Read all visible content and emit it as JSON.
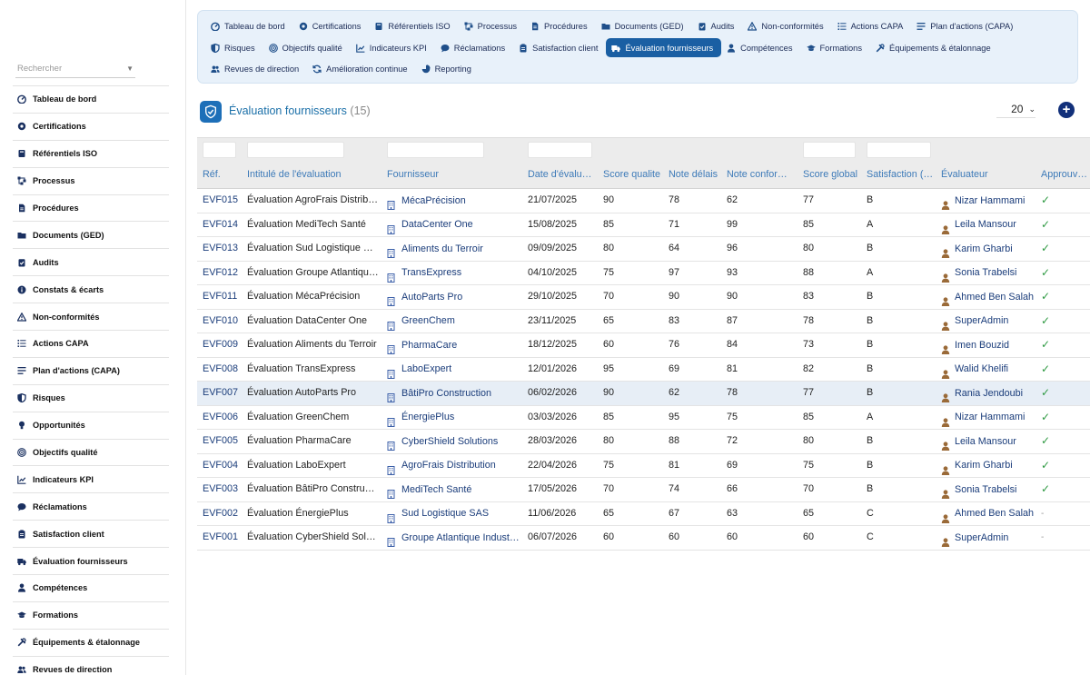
{
  "sidebar": {
    "search_placeholder": "Rechercher",
    "items": [
      {
        "label": "Tableau de bord",
        "icon": "dashboard-icon"
      },
      {
        "label": "Certifications",
        "icon": "certificate-icon"
      },
      {
        "label": "Référentiels ISO",
        "icon": "book-icon"
      },
      {
        "label": "Processus",
        "icon": "sitemap-icon"
      },
      {
        "label": "Procédures",
        "icon": "file-icon"
      },
      {
        "label": "Documents (GED)",
        "icon": "folder-icon"
      },
      {
        "label": "Audits",
        "icon": "clipboard-check-icon"
      },
      {
        "label": "Constats & écarts",
        "icon": "info-circle-icon"
      },
      {
        "label": "Non-conformités",
        "icon": "warning-icon"
      },
      {
        "label": "Actions CAPA",
        "icon": "list-icon"
      },
      {
        "label": "Plan d'actions (CAPA)",
        "icon": "tasks-icon"
      },
      {
        "label": "Risques",
        "icon": "shield-icon"
      },
      {
        "label": "Opportunités",
        "icon": "lightbulb-icon"
      },
      {
        "label": "Objectifs qualité",
        "icon": "target-icon"
      },
      {
        "label": "Indicateurs KPI",
        "icon": "line-chart-icon"
      },
      {
        "label": "Réclamations",
        "icon": "comment-icon"
      },
      {
        "label": "Satisfaction client",
        "icon": "clipboard-icon"
      },
      {
        "label": "Évaluation fournisseurs",
        "icon": "truck-icon"
      },
      {
        "label": "Compétences",
        "icon": "user-tie-icon"
      },
      {
        "label": "Formations",
        "icon": "graduation-cap-icon"
      },
      {
        "label": "Équipements & étalonnage",
        "icon": "tools-icon"
      },
      {
        "label": "Revues de direction",
        "icon": "users-icon"
      }
    ]
  },
  "topnav": {
    "rows": [
      [
        {
          "label": "Tableau de bord",
          "icon": "dashboard-icon"
        },
        {
          "label": "Certifications",
          "icon": "certificate-icon"
        },
        {
          "label": "Référentiels ISO",
          "icon": "book-icon"
        },
        {
          "label": "Processus",
          "icon": "sitemap-icon"
        },
        {
          "label": "Procédures",
          "icon": "file-icon"
        },
        {
          "label": "Documents (GED)",
          "icon": "folder-icon"
        },
        {
          "label": "Audits",
          "icon": "clipboard-check-icon"
        },
        {
          "label": "Non-conformités",
          "icon": "warning-icon"
        },
        {
          "label": "Actions CAPA",
          "icon": "list-icon"
        },
        {
          "label": "Plan d'actions (CAPA)",
          "icon": "tasks-icon"
        }
      ],
      [
        {
          "label": "Risques",
          "icon": "shield-icon"
        },
        {
          "label": "Objectifs qualité",
          "icon": "target-icon"
        },
        {
          "label": "Indicateurs KPI",
          "icon": "line-chart-icon"
        },
        {
          "label": "Réclamations",
          "icon": "comment-icon"
        },
        {
          "label": "Satisfaction client",
          "icon": "clipboard-icon"
        },
        {
          "label": "Évaluation fournisseurs",
          "icon": "truck-icon",
          "active": true
        },
        {
          "label": "Compétences",
          "icon": "user-tie-icon"
        },
        {
          "label": "Formations",
          "icon": "graduation-cap-icon"
        },
        {
          "label": "Équipements & étalonnage",
          "icon": "tools-icon"
        }
      ],
      [
        {
          "label": "Revues de direction",
          "icon": "users-icon"
        },
        {
          "label": "Amélioration continue",
          "icon": "sync-icon"
        },
        {
          "label": "Reporting",
          "icon": "pie-chart-icon"
        }
      ]
    ]
  },
  "header": {
    "title": "Évaluation fournisseurs",
    "count": "(15)",
    "page_size": "20"
  },
  "colors": {
    "accent": "#1a5fa3",
    "link": "#1a3c7a",
    "header_text": "#3d7ab8",
    "approved": "#2f9a43",
    "add_button": "#12307a"
  },
  "table": {
    "columns": [
      "Réf.",
      "Intitulé de l'évaluation",
      "Fournisseur",
      "Date d'évalu…",
      "Score qualite",
      "Note délais",
      "Note confor…",
      "Score global",
      "Satisfaction (…",
      "Évaluateur",
      "Approuv…"
    ],
    "rows": [
      {
        "ref": "EVF015",
        "title": "Évaluation AgroFrais Distrib…",
        "supplier": "MécaPrécision",
        "date": "21/07/2025",
        "quality": "90",
        "delay": "78",
        "conformity": "62",
        "global": "77",
        "satisfaction": "B",
        "evaluator": "Nizar Hammami",
        "approved": true
      },
      {
        "ref": "EVF014",
        "title": "Évaluation MediTech Santé",
        "supplier": "DataCenter One",
        "date": "15/08/2025",
        "quality": "85",
        "delay": "71",
        "conformity": "99",
        "global": "85",
        "satisfaction": "A",
        "evaluator": "Leila Mansour",
        "approved": true
      },
      {
        "ref": "EVF013",
        "title": "Évaluation Sud Logistique S…",
        "supplier": "Aliments du Terroir",
        "date": "09/09/2025",
        "quality": "80",
        "delay": "64",
        "conformity": "96",
        "global": "80",
        "satisfaction": "B",
        "evaluator": "Karim Gharbi",
        "approved": true
      },
      {
        "ref": "EVF012",
        "title": "Évaluation Groupe Atlantiqu…",
        "supplier": "TransExpress",
        "date": "04/10/2025",
        "quality": "75",
        "delay": "97",
        "conformity": "93",
        "global": "88",
        "satisfaction": "A",
        "evaluator": "Sonia Trabelsi",
        "approved": true
      },
      {
        "ref": "EVF011",
        "title": "Évaluation MécaPrécision",
        "supplier": "AutoParts Pro",
        "date": "29/10/2025",
        "quality": "70",
        "delay": "90",
        "conformity": "90",
        "global": "83",
        "satisfaction": "B",
        "evaluator": "Ahmed Ben Salah",
        "approved": true
      },
      {
        "ref": "EVF010",
        "title": "Évaluation DataCenter One",
        "supplier": "GreenChem",
        "date": "23/11/2025",
        "quality": "65",
        "delay": "83",
        "conformity": "87",
        "global": "78",
        "satisfaction": "B",
        "evaluator": "SuperAdmin",
        "approved": true
      },
      {
        "ref": "EVF009",
        "title": "Évaluation Aliments du Terroir",
        "supplier": "PharmaCare",
        "date": "18/12/2025",
        "quality": "60",
        "delay": "76",
        "conformity": "84",
        "global": "73",
        "satisfaction": "B",
        "evaluator": "Imen Bouzid",
        "approved": true
      },
      {
        "ref": "EVF008",
        "title": "Évaluation TransExpress",
        "supplier": "LaboExpert",
        "date": "12/01/2026",
        "quality": "95",
        "delay": "69",
        "conformity": "81",
        "global": "82",
        "satisfaction": "B",
        "evaluator": "Walid Khelifi",
        "approved": true
      },
      {
        "ref": "EVF007",
        "title": "Évaluation AutoParts Pro",
        "supplier": "BâtiPro Construction",
        "date": "06/02/2026",
        "quality": "90",
        "delay": "62",
        "conformity": "78",
        "global": "77",
        "satisfaction": "B",
        "evaluator": "Rania Jendoubi",
        "approved": true,
        "highlight": true
      },
      {
        "ref": "EVF006",
        "title": "Évaluation GreenChem",
        "supplier": "ÉnergiePlus",
        "date": "03/03/2026",
        "quality": "85",
        "delay": "95",
        "conformity": "75",
        "global": "85",
        "satisfaction": "A",
        "evaluator": "Nizar Hammami",
        "approved": true
      },
      {
        "ref": "EVF005",
        "title": "Évaluation PharmaCare",
        "supplier": "CyberShield Solutions",
        "date": "28/03/2026",
        "quality": "80",
        "delay": "88",
        "conformity": "72",
        "global": "80",
        "satisfaction": "B",
        "evaluator": "Leila Mansour",
        "approved": true
      },
      {
        "ref": "EVF004",
        "title": "Évaluation LaboExpert",
        "supplier": "AgroFrais Distribution",
        "date": "22/04/2026",
        "quality": "75",
        "delay": "81",
        "conformity": "69",
        "global": "75",
        "satisfaction": "B",
        "evaluator": "Karim Gharbi",
        "approved": true
      },
      {
        "ref": "EVF003",
        "title": "Évaluation BâtiPro Construc…",
        "supplier": "MediTech Santé",
        "date": "17/05/2026",
        "quality": "70",
        "delay": "74",
        "conformity": "66",
        "global": "70",
        "satisfaction": "B",
        "evaluator": "Sonia Trabelsi",
        "approved": true
      },
      {
        "ref": "EVF002",
        "title": "Évaluation ÉnergiePlus",
        "supplier": "Sud Logistique SAS",
        "date": "11/06/2026",
        "quality": "65",
        "delay": "67",
        "conformity": "63",
        "global": "65",
        "satisfaction": "C",
        "evaluator": "Ahmed Ben Salah",
        "approved": false
      },
      {
        "ref": "EVF001",
        "title": "Évaluation CyberShield Sol…",
        "supplier": "Groupe Atlantique Indust…",
        "date": "06/07/2026",
        "quality": "60",
        "delay": "60",
        "conformity": "60",
        "global": "60",
        "satisfaction": "C",
        "evaluator": "SuperAdmin",
        "approved": false
      }
    ]
  }
}
